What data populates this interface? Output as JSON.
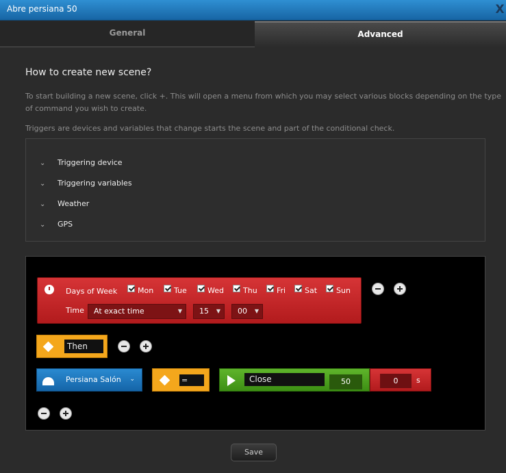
{
  "window": {
    "title": "Abre persiana 50",
    "close_glyph": "X"
  },
  "tabs": [
    {
      "label": "General"
    },
    {
      "label": "Advanced"
    }
  ],
  "help": {
    "heading": "How to create new scene?",
    "para1": "To start building a new scene, click +. This will open a menu from which you may select various blocks depending on the type of command you wish to create.",
    "para2": "Triggers are devices and variables that change starts the scene and part of the conditional check."
  },
  "triggers": [
    {
      "label": "Triggering device"
    },
    {
      "label": "Triggering variables"
    },
    {
      "label": "Weather"
    },
    {
      "label": "GPS"
    }
  ],
  "condition": {
    "days_label": "Days of Week",
    "days": [
      {
        "label": "Mon",
        "checked": true
      },
      {
        "label": "Tue",
        "checked": true
      },
      {
        "label": "Wed",
        "checked": true
      },
      {
        "label": "Thu",
        "checked": true
      },
      {
        "label": "Fri",
        "checked": true
      },
      {
        "label": "Sat",
        "checked": true
      },
      {
        "label": "Sun",
        "checked": true
      }
    ],
    "time_label": "Time",
    "time_mode": "At exact time",
    "hour": "15",
    "minute": "00"
  },
  "then_block": {
    "label": "Then"
  },
  "action_row": {
    "device": "Persiana Salón",
    "operator": "=",
    "command": "Close",
    "value": "50",
    "delay": "0",
    "delay_unit": "s"
  },
  "footer": {
    "save_label": "Save"
  },
  "colors": {
    "condition_red": "#c42628",
    "then_orange": "#f4a71c",
    "device_blue": "#1f78bf",
    "action_green": "#4ea21f",
    "title_blue": "#1e75bb"
  },
  "icons": {
    "chevron": "chevron-down-icon",
    "clock": "clock-icon",
    "diamond": "diamond-icon",
    "dome": "blind-device-icon",
    "play": "play-icon",
    "minus": "minus-circle-icon",
    "plus": "plus-circle-icon"
  }
}
